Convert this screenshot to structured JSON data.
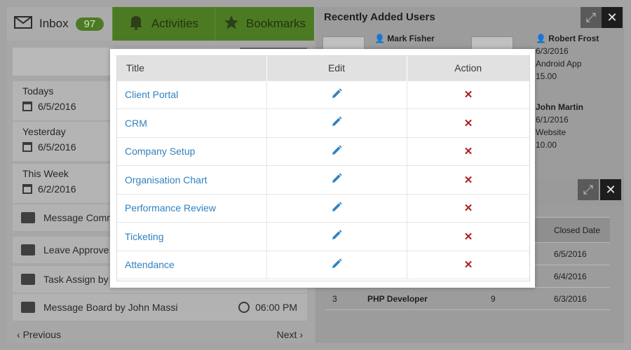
{
  "topbar": {
    "inbox_label": "Inbox",
    "inbox_count": "97",
    "activities_label": "Activities",
    "bookmarks_label": "Bookmarks"
  },
  "dates": [
    {
      "label": "Todays",
      "date": "6/5/2016"
    },
    {
      "label": "Yesterday",
      "date": "6/5/2016"
    },
    {
      "label": "This Week",
      "date": "6/2/2016"
    }
  ],
  "feed": [
    {
      "text": "Message Comm",
      "icon": "comment-icon"
    },
    {
      "text": "Leave Approve",
      "icon": "user-check-icon"
    },
    {
      "text": "Task Assign by",
      "icon": "clipboard-icon"
    },
    {
      "text": "Message Board by John Massi",
      "time": "06:00 PM",
      "icon": "envelope-icon"
    }
  ],
  "pager": {
    "previous": "Previous",
    "next": "Next"
  },
  "recent_users": {
    "title": "Recently Added Users",
    "users": [
      {
        "name": "Mark Fisher"
      },
      {
        "name": "Robert Frost",
        "date": "6/3/2016",
        "source": "Android App",
        "amount": "15.00"
      },
      {
        "name": "John Martin",
        "date": "6/1/2016",
        "source": "Website",
        "amount": "10.00"
      }
    ]
  },
  "jobs_table": {
    "closed_date_header": "Closed Date",
    "rows": [
      {
        "num": "",
        "title": "",
        "count": "",
        "closed": "6/5/2016"
      },
      {
        "num": "",
        "title": "",
        "count": "",
        "closed": "6/4/2016"
      },
      {
        "num": "3",
        "title": "PHP Developer",
        "count": "9",
        "closed": "6/3/2016"
      }
    ]
  },
  "modal": {
    "close_glyph": "×",
    "headers": {
      "title": "Title",
      "edit": "Edit",
      "action": "Action"
    },
    "rows": [
      {
        "title": "Client Portal"
      },
      {
        "title": "CRM"
      },
      {
        "title": "Company Setup"
      },
      {
        "title": "Organisation Chart"
      },
      {
        "title": "Performance Review"
      },
      {
        "title": "Ticketing"
      },
      {
        "title": "Attendance"
      }
    ],
    "link_color": "#2f82c2",
    "delete_color": "#b01c1c",
    "edit_color": "#2f82c2"
  }
}
